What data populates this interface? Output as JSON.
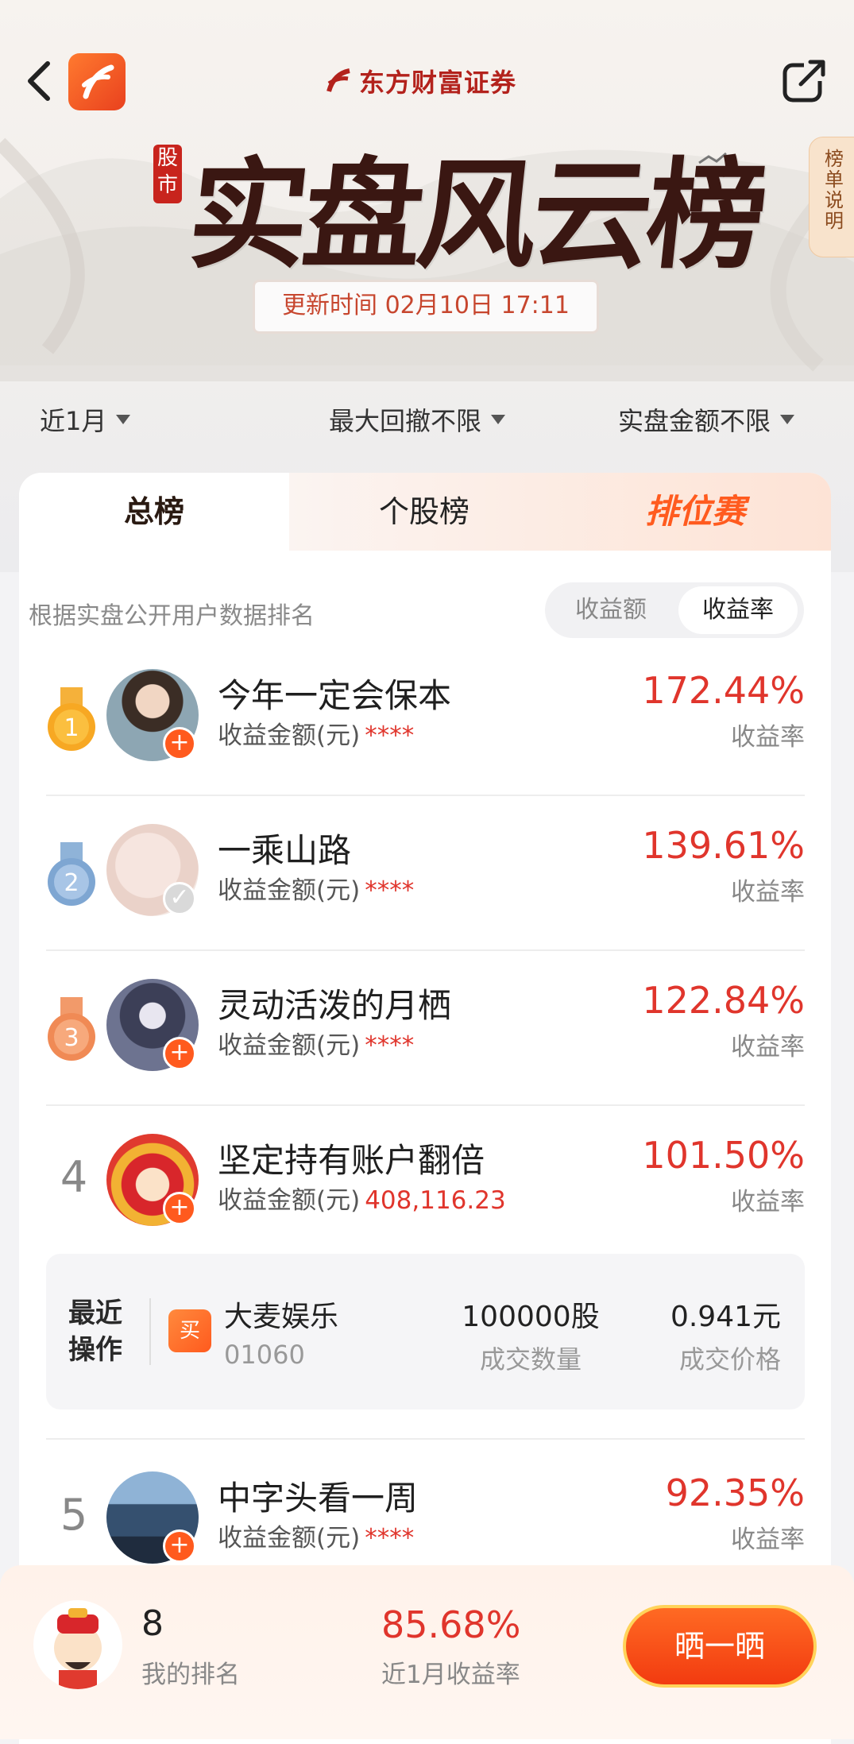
{
  "header": {
    "brand": "东方财富证券",
    "seal_text": "股市",
    "title": "实盘风云榜",
    "update_time": "更新时间 02月10日 17:11",
    "side_tag": "榜单说明"
  },
  "filters": [
    {
      "label": "近1月"
    },
    {
      "label": "最大回撤不限"
    },
    {
      "label": "实盘金额不限"
    }
  ],
  "tabs": [
    {
      "label": "总榜"
    },
    {
      "label": "个股榜"
    },
    {
      "label": "排位赛"
    }
  ],
  "list_note": "根据实盘公开用户数据排名",
  "segment": [
    "收益额",
    "收益率"
  ],
  "rows": [
    {
      "rank": "1",
      "name": "今年一定会保本",
      "amount_label": "收益金额(元)",
      "amount": "****",
      "rate": "172.44%",
      "rate_label": "收益率"
    },
    {
      "rank": "2",
      "name": "一乘山路",
      "amount_label": "收益金额(元)",
      "amount": "****",
      "rate": "139.61%",
      "rate_label": "收益率"
    },
    {
      "rank": "3",
      "name": "灵动活泼的月栖",
      "amount_label": "收益金额(元)",
      "amount": "****",
      "rate": "122.84%",
      "rate_label": "收益率"
    },
    {
      "rank": "4",
      "name": "坚定持有账户翻倍",
      "amount_label": "收益金额(元)",
      "amount": "408,116.23",
      "rate": "101.50%",
      "rate_label": "收益率"
    },
    {
      "rank": "5",
      "name": "中字头看一周",
      "amount_label": "收益金额(元)",
      "amount": "****",
      "rate": "92.35%",
      "rate_label": "收益率"
    }
  ],
  "recent_op": {
    "title": "最近操作",
    "side": "买",
    "stock": "大麦娱乐",
    "code": "01060",
    "quantity": "100000股",
    "quantity_label": "成交数量",
    "price": "0.941元",
    "price_label": "成交价格"
  },
  "my": {
    "rank": "8",
    "rank_label": "我的排名",
    "rate": "85.68%",
    "rate_label": "近1月收益率",
    "button": "晒一晒"
  },
  "colors": {
    "accent": "#e0352c",
    "orange": "#ff5a1e"
  }
}
